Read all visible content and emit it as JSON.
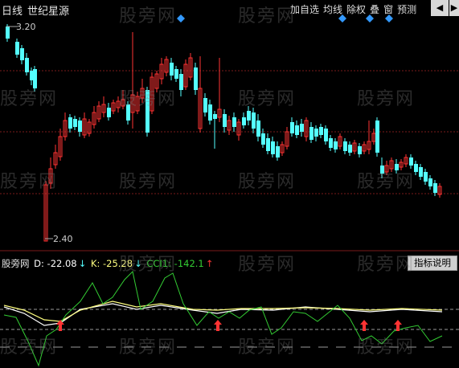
{
  "topbar": {
    "period": "日线",
    "indicator_name": "世纪星源",
    "menu": [
      "加自选",
      "均线",
      "除权",
      "叠",
      "窗",
      "预测"
    ],
    "nav_back": "◀",
    "nav_fwd": "▶"
  },
  "price_chart": {
    "high_label": "3.20",
    "low_label": "2.40"
  },
  "indicator": {
    "name": "股旁网",
    "d_label": "D: -22.08",
    "d_arrow": "↓",
    "k_label": "K: -25.28",
    "k_arrow": "↓",
    "cci_label": "CCI1: -142.1",
    "cci_arrow": "↑",
    "explain_button": "指标说明"
  },
  "watermark": "股旁网",
  "colors": {
    "up": "#ff3333",
    "down": "#54ffff",
    "grid": "#7a1a1a",
    "k_line": "#ffff80",
    "d_line": "#ffffff",
    "cci_line": "#33cc33",
    "signal": "#ff3333",
    "diamond": "#3399ff"
  }
}
